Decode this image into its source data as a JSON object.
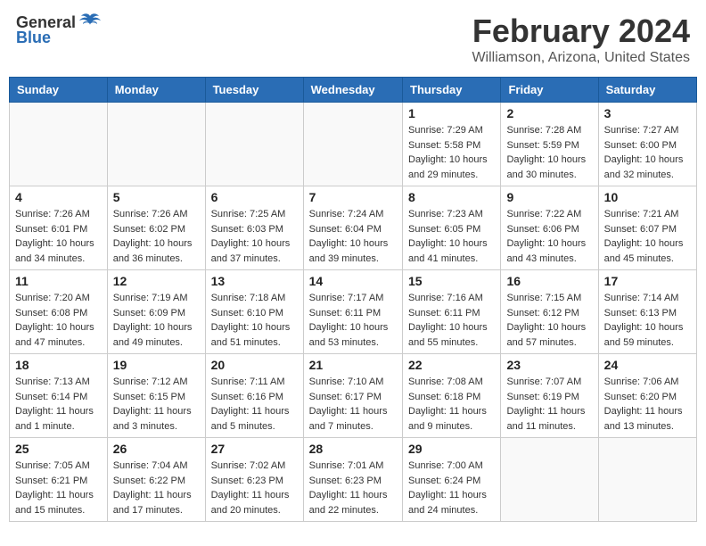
{
  "header": {
    "logo_general": "General",
    "logo_blue": "Blue",
    "month_title": "February 2024",
    "location": "Williamson, Arizona, United States"
  },
  "weekdays": [
    "Sunday",
    "Monday",
    "Tuesday",
    "Wednesday",
    "Thursday",
    "Friday",
    "Saturday"
  ],
  "weeks": [
    [
      {
        "day": "",
        "sunrise": "",
        "sunset": "",
        "daylight": ""
      },
      {
        "day": "",
        "sunrise": "",
        "sunset": "",
        "daylight": ""
      },
      {
        "day": "",
        "sunrise": "",
        "sunset": "",
        "daylight": ""
      },
      {
        "day": "",
        "sunrise": "",
        "sunset": "",
        "daylight": ""
      },
      {
        "day": "1",
        "sunrise": "Sunrise: 7:29 AM",
        "sunset": "Sunset: 5:58 PM",
        "daylight": "Daylight: 10 hours and 29 minutes."
      },
      {
        "day": "2",
        "sunrise": "Sunrise: 7:28 AM",
        "sunset": "Sunset: 5:59 PM",
        "daylight": "Daylight: 10 hours and 30 minutes."
      },
      {
        "day": "3",
        "sunrise": "Sunrise: 7:27 AM",
        "sunset": "Sunset: 6:00 PM",
        "daylight": "Daylight: 10 hours and 32 minutes."
      }
    ],
    [
      {
        "day": "4",
        "sunrise": "Sunrise: 7:26 AM",
        "sunset": "Sunset: 6:01 PM",
        "daylight": "Daylight: 10 hours and 34 minutes."
      },
      {
        "day": "5",
        "sunrise": "Sunrise: 7:26 AM",
        "sunset": "Sunset: 6:02 PM",
        "daylight": "Daylight: 10 hours and 36 minutes."
      },
      {
        "day": "6",
        "sunrise": "Sunrise: 7:25 AM",
        "sunset": "Sunset: 6:03 PM",
        "daylight": "Daylight: 10 hours and 37 minutes."
      },
      {
        "day": "7",
        "sunrise": "Sunrise: 7:24 AM",
        "sunset": "Sunset: 6:04 PM",
        "daylight": "Daylight: 10 hours and 39 minutes."
      },
      {
        "day": "8",
        "sunrise": "Sunrise: 7:23 AM",
        "sunset": "Sunset: 6:05 PM",
        "daylight": "Daylight: 10 hours and 41 minutes."
      },
      {
        "day": "9",
        "sunrise": "Sunrise: 7:22 AM",
        "sunset": "Sunset: 6:06 PM",
        "daylight": "Daylight: 10 hours and 43 minutes."
      },
      {
        "day": "10",
        "sunrise": "Sunrise: 7:21 AM",
        "sunset": "Sunset: 6:07 PM",
        "daylight": "Daylight: 10 hours and 45 minutes."
      }
    ],
    [
      {
        "day": "11",
        "sunrise": "Sunrise: 7:20 AM",
        "sunset": "Sunset: 6:08 PM",
        "daylight": "Daylight: 10 hours and 47 minutes."
      },
      {
        "day": "12",
        "sunrise": "Sunrise: 7:19 AM",
        "sunset": "Sunset: 6:09 PM",
        "daylight": "Daylight: 10 hours and 49 minutes."
      },
      {
        "day": "13",
        "sunrise": "Sunrise: 7:18 AM",
        "sunset": "Sunset: 6:10 PM",
        "daylight": "Daylight: 10 hours and 51 minutes."
      },
      {
        "day": "14",
        "sunrise": "Sunrise: 7:17 AM",
        "sunset": "Sunset: 6:11 PM",
        "daylight": "Daylight: 10 hours and 53 minutes."
      },
      {
        "day": "15",
        "sunrise": "Sunrise: 7:16 AM",
        "sunset": "Sunset: 6:11 PM",
        "daylight": "Daylight: 10 hours and 55 minutes."
      },
      {
        "day": "16",
        "sunrise": "Sunrise: 7:15 AM",
        "sunset": "Sunset: 6:12 PM",
        "daylight": "Daylight: 10 hours and 57 minutes."
      },
      {
        "day": "17",
        "sunrise": "Sunrise: 7:14 AM",
        "sunset": "Sunset: 6:13 PM",
        "daylight": "Daylight: 10 hours and 59 minutes."
      }
    ],
    [
      {
        "day": "18",
        "sunrise": "Sunrise: 7:13 AM",
        "sunset": "Sunset: 6:14 PM",
        "daylight": "Daylight: 11 hours and 1 minute."
      },
      {
        "day": "19",
        "sunrise": "Sunrise: 7:12 AM",
        "sunset": "Sunset: 6:15 PM",
        "daylight": "Daylight: 11 hours and 3 minutes."
      },
      {
        "day": "20",
        "sunrise": "Sunrise: 7:11 AM",
        "sunset": "Sunset: 6:16 PM",
        "daylight": "Daylight: 11 hours and 5 minutes."
      },
      {
        "day": "21",
        "sunrise": "Sunrise: 7:10 AM",
        "sunset": "Sunset: 6:17 PM",
        "daylight": "Daylight: 11 hours and 7 minutes."
      },
      {
        "day": "22",
        "sunrise": "Sunrise: 7:08 AM",
        "sunset": "Sunset: 6:18 PM",
        "daylight": "Daylight: 11 hours and 9 minutes."
      },
      {
        "day": "23",
        "sunrise": "Sunrise: 7:07 AM",
        "sunset": "Sunset: 6:19 PM",
        "daylight": "Daylight: 11 hours and 11 minutes."
      },
      {
        "day": "24",
        "sunrise": "Sunrise: 7:06 AM",
        "sunset": "Sunset: 6:20 PM",
        "daylight": "Daylight: 11 hours and 13 minutes."
      }
    ],
    [
      {
        "day": "25",
        "sunrise": "Sunrise: 7:05 AM",
        "sunset": "Sunset: 6:21 PM",
        "daylight": "Daylight: 11 hours and 15 minutes."
      },
      {
        "day": "26",
        "sunrise": "Sunrise: 7:04 AM",
        "sunset": "Sunset: 6:22 PM",
        "daylight": "Daylight: 11 hours and 17 minutes."
      },
      {
        "day": "27",
        "sunrise": "Sunrise: 7:02 AM",
        "sunset": "Sunset: 6:23 PM",
        "daylight": "Daylight: 11 hours and 20 minutes."
      },
      {
        "day": "28",
        "sunrise": "Sunrise: 7:01 AM",
        "sunset": "Sunset: 6:23 PM",
        "daylight": "Daylight: 11 hours and 22 minutes."
      },
      {
        "day": "29",
        "sunrise": "Sunrise: 7:00 AM",
        "sunset": "Sunset: 6:24 PM",
        "daylight": "Daylight: 11 hours and 24 minutes."
      },
      {
        "day": "",
        "sunrise": "",
        "sunset": "",
        "daylight": ""
      },
      {
        "day": "",
        "sunrise": "",
        "sunset": "",
        "daylight": ""
      }
    ]
  ]
}
